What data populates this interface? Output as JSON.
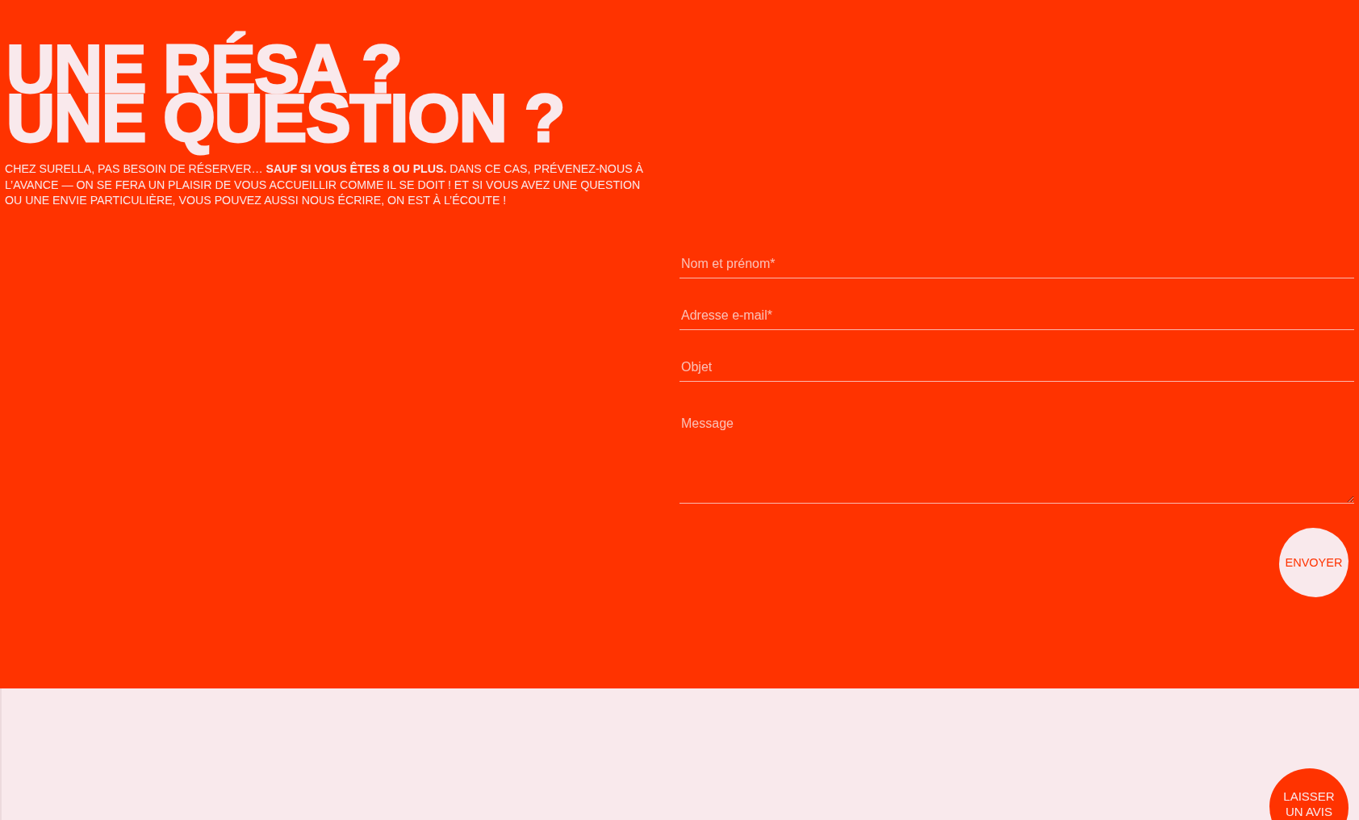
{
  "contact": {
    "heading_lines": [
      "UNE RÉSA ?",
      "UNE QUESTION ?"
    ],
    "intro": "CHEZ SURELLA, PAS BESOIN DE RÉSERVER… **SAUF SI VOUS ÊTES 8 OU PLUS.** DANS CE CAS, PRÉVENEZ-NOUS À L’AVANCE — ON SE FERA UN PLAISIR DE VOUS ACCUEILLIR COMME IL SE DOIT ! ET SI VOUS AVEZ UNE QUESTION OU UNE ENVIE PARTICULIÈRE, VOUS POUVEZ AUSSI NOUS ÉCRIRE, ON EST À L’ÉCOUTE !",
    "form": {
      "fields": [
        {
          "kind": "input",
          "placeholder": "Nom et prénom*"
        },
        {
          "kind": "input",
          "placeholder": "Adresse e-mail*"
        },
        {
          "kind": "input",
          "placeholder": "Objet"
        },
        {
          "kind": "textarea",
          "placeholder": "Message"
        }
      ],
      "submit": "ENVOYER"
    }
  },
  "review_button": "LAISSER UN AVIS"
}
